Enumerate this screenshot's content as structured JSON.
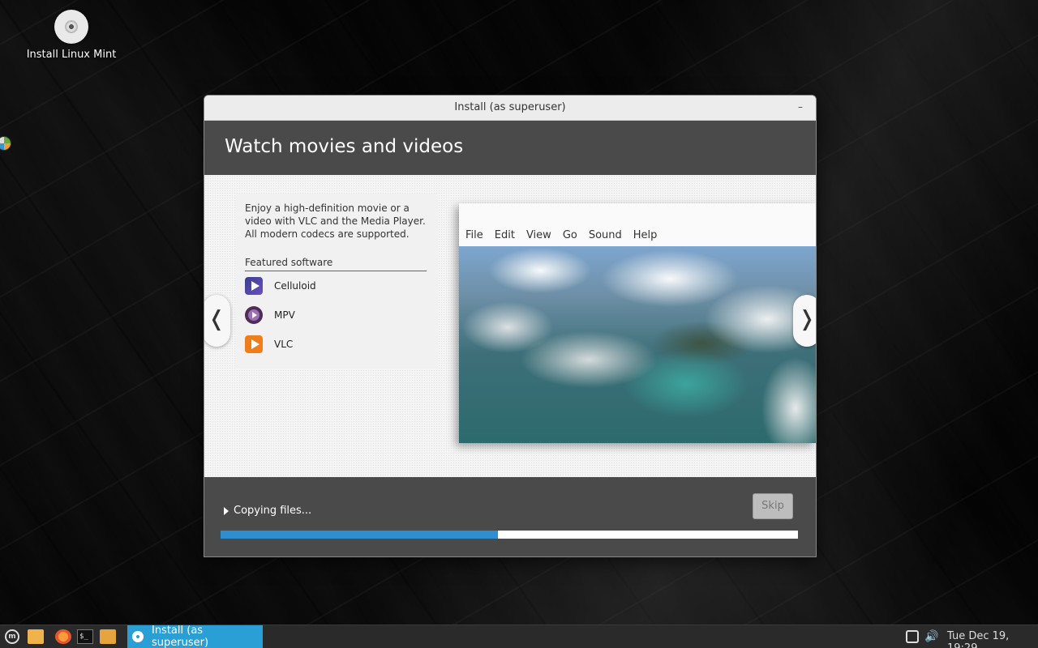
{
  "desktop": {
    "icon_label": "Install Linux Mint"
  },
  "window": {
    "title": "Install (as superuser)",
    "minimize_label": "–",
    "header_title": "Watch movies and videos",
    "description": "Enjoy a high-definition movie or a video with VLC and the Media Player. All modern codecs are supported.",
    "featured_heading": "Featured software",
    "apps": [
      {
        "name": "Celluloid",
        "icon": "celluloid-icon"
      },
      {
        "name": "MPV",
        "icon": "mpv-icon"
      },
      {
        "name": "VLC",
        "icon": "vlc-icon"
      }
    ],
    "screenshot_menu": [
      "File",
      "Edit",
      "View",
      "Go",
      "Sound",
      "Help"
    ],
    "nav_prev": "❬",
    "nav_next": "❭",
    "status_text": "Copying files...",
    "skip_label": "Skip",
    "progress": 0.48
  },
  "taskbar": {
    "task_label": "Install (as superuser)",
    "clock": "Tue Dec 19, 19:29",
    "accent_color": "#2a9fd6"
  }
}
